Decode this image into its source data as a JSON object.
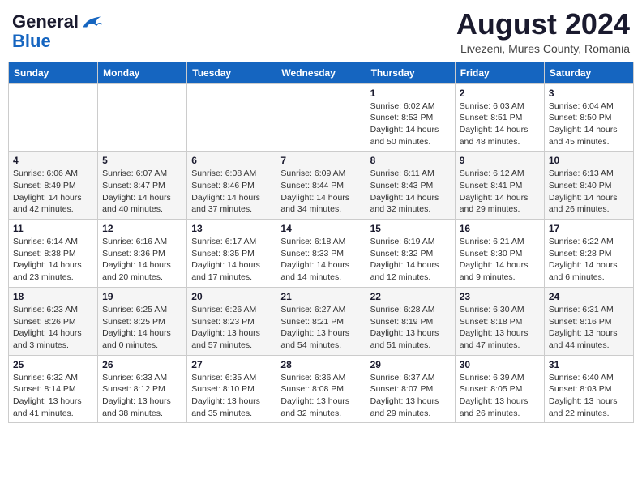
{
  "header": {
    "logo": {
      "general": "General",
      "blue": "Blue",
      "bird_label": "logo-bird"
    },
    "month_year": "August 2024",
    "location": "Livezeni, Mures County, Romania"
  },
  "calendar": {
    "days_of_week": [
      "Sunday",
      "Monday",
      "Tuesday",
      "Wednesday",
      "Thursday",
      "Friday",
      "Saturday"
    ],
    "weeks": [
      [
        {
          "day": "",
          "info": ""
        },
        {
          "day": "",
          "info": ""
        },
        {
          "day": "",
          "info": ""
        },
        {
          "day": "",
          "info": ""
        },
        {
          "day": "1",
          "info": "Sunrise: 6:02 AM\nSunset: 8:53 PM\nDaylight: 14 hours\nand 50 minutes."
        },
        {
          "day": "2",
          "info": "Sunrise: 6:03 AM\nSunset: 8:51 PM\nDaylight: 14 hours\nand 48 minutes."
        },
        {
          "day": "3",
          "info": "Sunrise: 6:04 AM\nSunset: 8:50 PM\nDaylight: 14 hours\nand 45 minutes."
        }
      ],
      [
        {
          "day": "4",
          "info": "Sunrise: 6:06 AM\nSunset: 8:49 PM\nDaylight: 14 hours\nand 42 minutes."
        },
        {
          "day": "5",
          "info": "Sunrise: 6:07 AM\nSunset: 8:47 PM\nDaylight: 14 hours\nand 40 minutes."
        },
        {
          "day": "6",
          "info": "Sunrise: 6:08 AM\nSunset: 8:46 PM\nDaylight: 14 hours\nand 37 minutes."
        },
        {
          "day": "7",
          "info": "Sunrise: 6:09 AM\nSunset: 8:44 PM\nDaylight: 14 hours\nand 34 minutes."
        },
        {
          "day": "8",
          "info": "Sunrise: 6:11 AM\nSunset: 8:43 PM\nDaylight: 14 hours\nand 32 minutes."
        },
        {
          "day": "9",
          "info": "Sunrise: 6:12 AM\nSunset: 8:41 PM\nDaylight: 14 hours\nand 29 minutes."
        },
        {
          "day": "10",
          "info": "Sunrise: 6:13 AM\nSunset: 8:40 PM\nDaylight: 14 hours\nand 26 minutes."
        }
      ],
      [
        {
          "day": "11",
          "info": "Sunrise: 6:14 AM\nSunset: 8:38 PM\nDaylight: 14 hours\nand 23 minutes."
        },
        {
          "day": "12",
          "info": "Sunrise: 6:16 AM\nSunset: 8:36 PM\nDaylight: 14 hours\nand 20 minutes."
        },
        {
          "day": "13",
          "info": "Sunrise: 6:17 AM\nSunset: 8:35 PM\nDaylight: 14 hours\nand 17 minutes."
        },
        {
          "day": "14",
          "info": "Sunrise: 6:18 AM\nSunset: 8:33 PM\nDaylight: 14 hours\nand 14 minutes."
        },
        {
          "day": "15",
          "info": "Sunrise: 6:19 AM\nSunset: 8:32 PM\nDaylight: 14 hours\nand 12 minutes."
        },
        {
          "day": "16",
          "info": "Sunrise: 6:21 AM\nSunset: 8:30 PM\nDaylight: 14 hours\nand 9 minutes."
        },
        {
          "day": "17",
          "info": "Sunrise: 6:22 AM\nSunset: 8:28 PM\nDaylight: 14 hours\nand 6 minutes."
        }
      ],
      [
        {
          "day": "18",
          "info": "Sunrise: 6:23 AM\nSunset: 8:26 PM\nDaylight: 14 hours\nand 3 minutes."
        },
        {
          "day": "19",
          "info": "Sunrise: 6:25 AM\nSunset: 8:25 PM\nDaylight: 14 hours\nand 0 minutes."
        },
        {
          "day": "20",
          "info": "Sunrise: 6:26 AM\nSunset: 8:23 PM\nDaylight: 13 hours\nand 57 minutes."
        },
        {
          "day": "21",
          "info": "Sunrise: 6:27 AM\nSunset: 8:21 PM\nDaylight: 13 hours\nand 54 minutes."
        },
        {
          "day": "22",
          "info": "Sunrise: 6:28 AM\nSunset: 8:19 PM\nDaylight: 13 hours\nand 51 minutes."
        },
        {
          "day": "23",
          "info": "Sunrise: 6:30 AM\nSunset: 8:18 PM\nDaylight: 13 hours\nand 47 minutes."
        },
        {
          "day": "24",
          "info": "Sunrise: 6:31 AM\nSunset: 8:16 PM\nDaylight: 13 hours\nand 44 minutes."
        }
      ],
      [
        {
          "day": "25",
          "info": "Sunrise: 6:32 AM\nSunset: 8:14 PM\nDaylight: 13 hours\nand 41 minutes."
        },
        {
          "day": "26",
          "info": "Sunrise: 6:33 AM\nSunset: 8:12 PM\nDaylight: 13 hours\nand 38 minutes."
        },
        {
          "day": "27",
          "info": "Sunrise: 6:35 AM\nSunset: 8:10 PM\nDaylight: 13 hours\nand 35 minutes."
        },
        {
          "day": "28",
          "info": "Sunrise: 6:36 AM\nSunset: 8:08 PM\nDaylight: 13 hours\nand 32 minutes."
        },
        {
          "day": "29",
          "info": "Sunrise: 6:37 AM\nSunset: 8:07 PM\nDaylight: 13 hours\nand 29 minutes."
        },
        {
          "day": "30",
          "info": "Sunrise: 6:39 AM\nSunset: 8:05 PM\nDaylight: 13 hours\nand 26 minutes."
        },
        {
          "day": "31",
          "info": "Sunrise: 6:40 AM\nSunset: 8:03 PM\nDaylight: 13 hours\nand 22 minutes."
        }
      ]
    ]
  }
}
